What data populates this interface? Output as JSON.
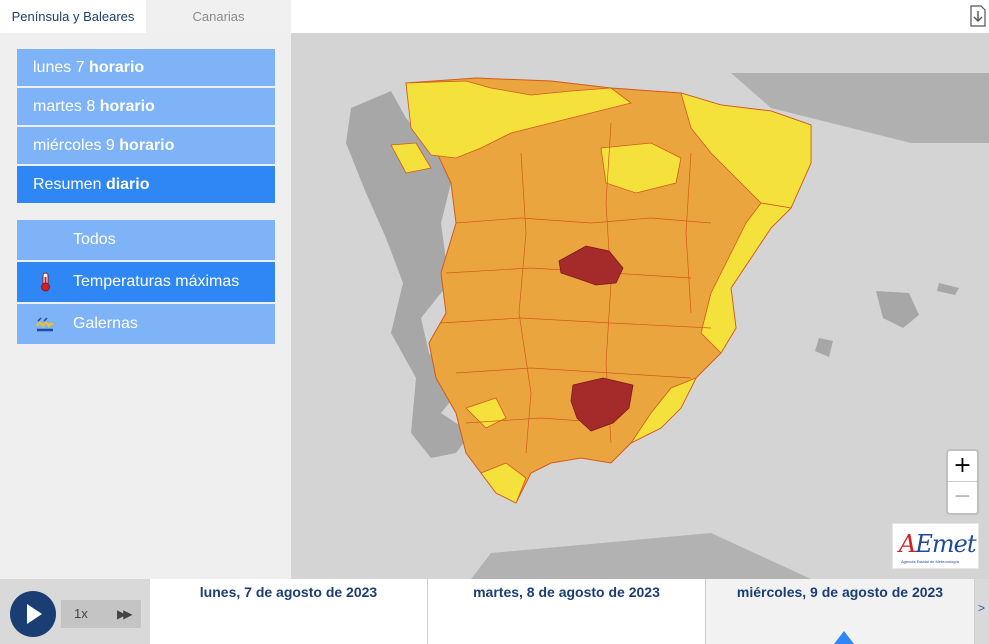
{
  "tabs": [
    {
      "label": "Península y Baleares",
      "active": true
    },
    {
      "label": "Canarias",
      "active": false
    }
  ],
  "days": [
    {
      "day": "lunes 7",
      "mode": "horario"
    },
    {
      "day": "martes 8",
      "mode": "horario"
    },
    {
      "day": "miércoles 9",
      "mode": "horario"
    },
    {
      "day": "Resumen",
      "mode": "diario"
    }
  ],
  "filters": [
    {
      "label": "Todos",
      "icon": "none"
    },
    {
      "label": "Temperaturas máximas",
      "icon": "thermometer-icon"
    },
    {
      "label": "Galernas",
      "icon": "galerna-icon"
    }
  ],
  "map": {
    "colors": {
      "sea": "#d4d4d4",
      "land": "#a7a7a7",
      "yellow": "#f4e13c",
      "orange": "#eaa53e",
      "red": "#a52a2a",
      "border": "#d35a1a"
    },
    "zoom_in": "+",
    "zoom_out": "−",
    "logo": {
      "brand_a": "A",
      "brand_rest": "Emet",
      "subtitle": "Agencia Estatal de Meteorología"
    }
  },
  "player": {
    "speed": "1x",
    "fast_forward": "▶▶",
    "prev": "<",
    "next": ">"
  },
  "timeline": [
    {
      "label": "lunes, 7 de agosto de 2023",
      "selected": false
    },
    {
      "label": "martes, 8 de agosto de 2023",
      "selected": false
    },
    {
      "label": "miércoles, 9 de agosto de 2023",
      "selected": true
    }
  ]
}
